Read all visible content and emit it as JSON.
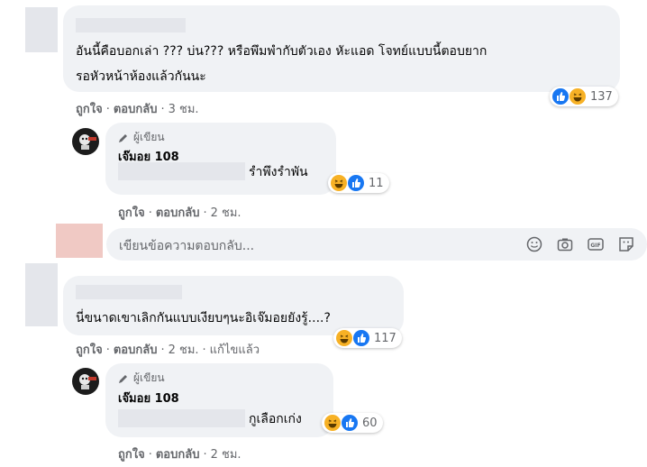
{
  "comments": [
    {
      "text_line1": "อันนี้คือบอกเล่า ??? บ่น??? หรือพึมพำกับตัวเอง หัะแอด โจทย์แบบนี้ตอบยาก",
      "text_line2": "รอหัวหน้าห้องแล้วกันนะ",
      "actions": {
        "like": "ถูกใจ",
        "reply": "ตอบกลับ",
        "time": "3 ชม."
      },
      "reaction_count": "137",
      "reactions": [
        "like-icon",
        "haha-icon"
      ],
      "reply": {
        "badge": "ผู้เขียน",
        "author": "เจ๊มอย 108",
        "text": "รำพึงรำพัน",
        "reaction_count": "11",
        "actions": {
          "like": "ถูกใจ",
          "reply": "ตอบกลับ",
          "time": "2 ชม."
        }
      }
    },
    {
      "text": "นี่ขนาดเขาเลิกกันแบบเงียบๆนะอิเจ๊มอยยังรู้....?",
      "actions": {
        "like": "ถูกใจ",
        "reply": "ตอบกลับ",
        "time": "2 ชม.",
        "edited": "แก้ไขแล้ว"
      },
      "reaction_count": "117",
      "reactions": [
        "haha-icon",
        "like-icon"
      ],
      "reply": {
        "badge": "ผู้เขียน",
        "author": "เจ๊มอย 108",
        "text": "กูเลือกเก่ง",
        "reaction_count": "60",
        "actions": {
          "like": "ถูกใจ",
          "reply": "ตอบกลับ",
          "time": "2 ชม."
        }
      }
    }
  ],
  "reply_input": {
    "placeholder": "เขียนข้อความตอบกลับ..."
  },
  "colors": {
    "like": "#1877f2",
    "haha": "#f7b125",
    "bubble": "#f0f2f5",
    "meta": "#65676b"
  }
}
